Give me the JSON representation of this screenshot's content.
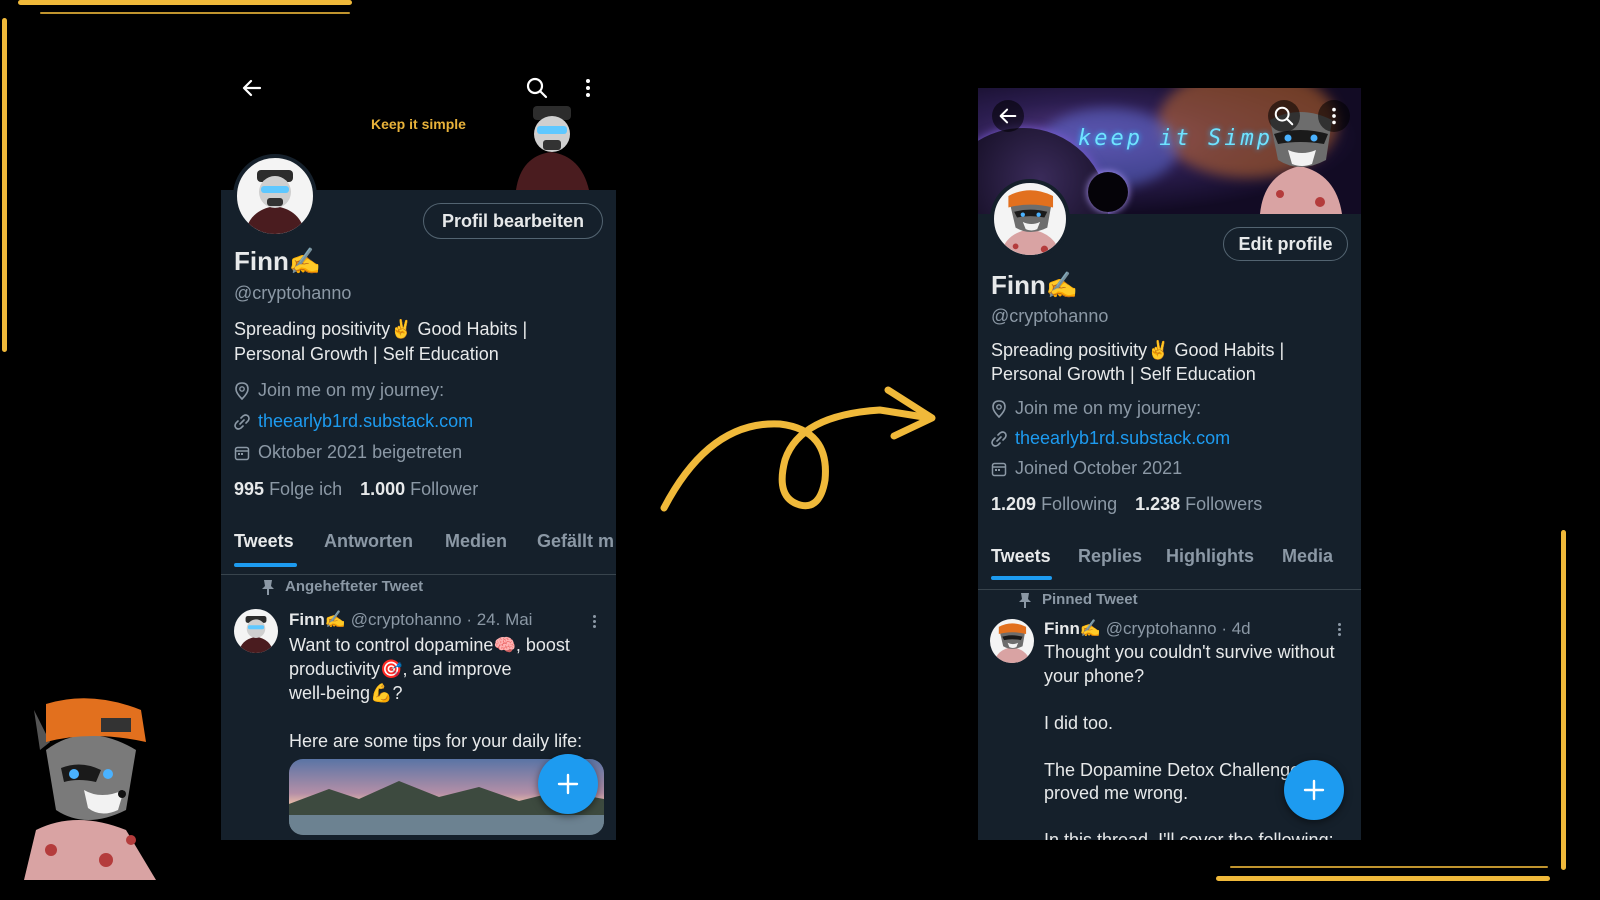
{
  "left": {
    "banner_text": "Keep it simple",
    "edit_label": "Profil bearbeiten",
    "name": "Finn✍️",
    "handle": "@cryptohanno",
    "bio_line1": "Spreading positivity✌️ Good Habits |",
    "bio_line2": "Personal Growth | Self Education",
    "location": "Join me on my journey:",
    "website": "theearlyb1rd.substack.com",
    "joined": "Oktober 2021 beigetreten",
    "following_count": "995",
    "following_label": "Folge ich",
    "followers_count": "1.000",
    "followers_label": "Follower",
    "tabs": [
      "Tweets",
      "Antworten",
      "Medien",
      "Gefällt m"
    ],
    "pinned_label": "Angehefteter Tweet",
    "tweet_name": "Finn✍️",
    "tweet_meta": "@cryptohanno · 24. Mai",
    "tweet_lines": [
      "Want to control dopamine🧠, boost",
      "productivity🎯, and improve",
      "well-being💪?",
      "",
      "Here are some tips for your daily life:"
    ]
  },
  "right": {
    "banner_text": "keep it Simple",
    "edit_label": "Edit profile",
    "name": "Finn✍️",
    "handle": "@cryptohanno",
    "bio_line1": "Spreading positivity✌️ Good Habits |",
    "bio_line2": "Personal Growth | Self Education",
    "location": "Join me on my journey:",
    "website": "theearlyb1rd.substack.com",
    "joined": "Joined October 2021",
    "following_count": "1.209",
    "following_label": "Following",
    "followers_count": "1.238",
    "followers_label": "Followers",
    "tabs": [
      "Tweets",
      "Replies",
      "Highlights",
      "Media"
    ],
    "pinned_label": "Pinned Tweet",
    "tweet_name": "Finn✍️",
    "tweet_meta": "@cryptohanno · 4d",
    "tweet_lines": [
      "Thought you couldn't survive without",
      "your phone?",
      "",
      "I did too.",
      "",
      "The Dopamine Detox Challenge",
      "proved me wrong.",
      "",
      "In this thread, I'll cover the following:"
    ]
  },
  "icons": {
    "back": "back-arrow-icon",
    "search": "search-icon",
    "more": "more-vertical-icon",
    "location": "location-pin-icon",
    "link": "link-icon",
    "calendar": "calendar-icon",
    "pin": "pin-icon",
    "compose": "plus-icon"
  },
  "colors": {
    "accent": "#1d9bf0",
    "background": "#15202b",
    "brush": "#f0b93a"
  }
}
